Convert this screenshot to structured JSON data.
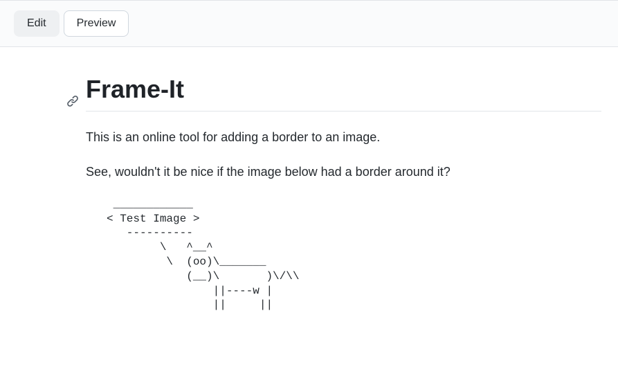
{
  "tabs": {
    "edit": "Edit",
    "preview": "Preview"
  },
  "document": {
    "title": "Frame-It",
    "paragraph1": "This is an online tool for adding a border to an image.",
    "paragraph2": "See, wouldn't it be nice if the image below had a border around it?",
    "ascii_art": " ____________\n< Test Image >\n   ----------\n        \\   ^__^\n         \\  (oo)\\_______\n            (__)\\       )\\/\\\\\n                ||----w |\n                ||     ||"
  }
}
